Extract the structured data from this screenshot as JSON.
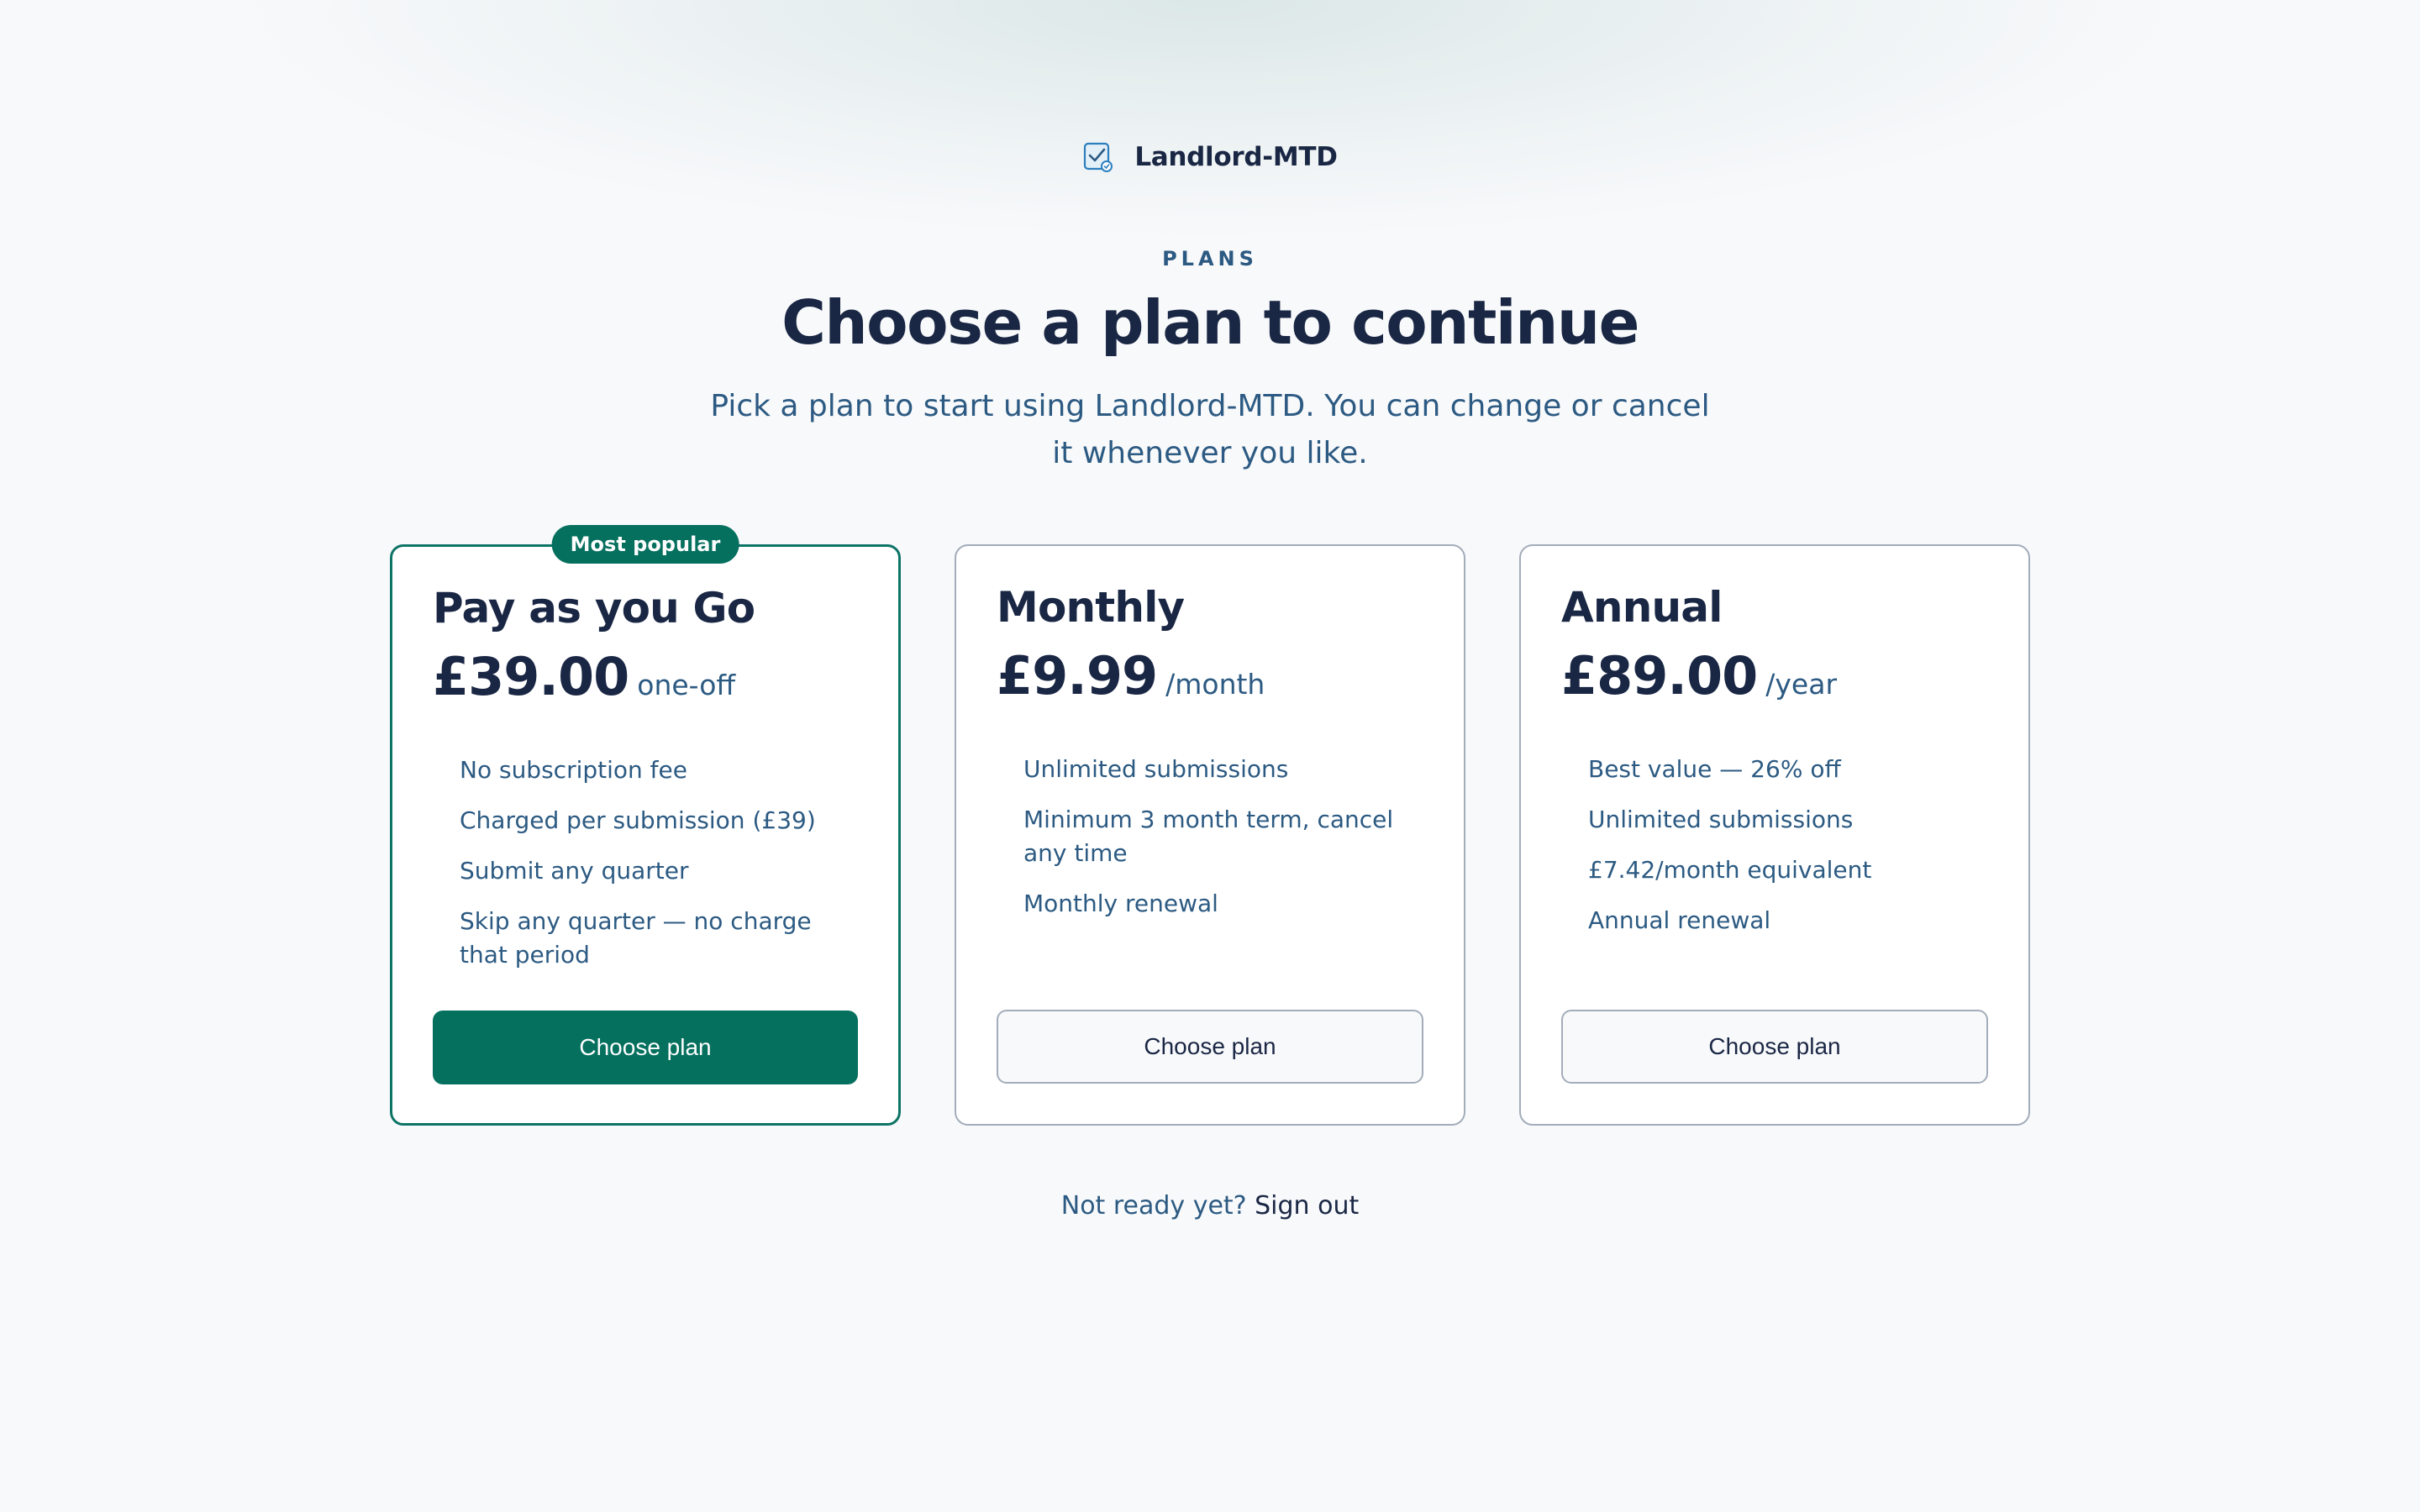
{
  "brand": {
    "name": "Landlord-MTD",
    "icon": "checklist-icon"
  },
  "header": {
    "eyebrow": "PLANS",
    "title": "Choose a plan to continue",
    "subtitle": "Pick a plan to start using Landlord-MTD. You can change or cancel it whenever you like."
  },
  "plans": [
    {
      "name": "Pay as you Go",
      "badge": "Most popular",
      "price": "£39.00",
      "period": "one-off",
      "features": [
        "No subscription fee",
        "Charged per submission (£39)",
        "Submit any quarter",
        "Skip any quarter — no charge that period"
      ],
      "cta": "Choose plan"
    },
    {
      "name": "Monthly",
      "price": "£9.99",
      "period": "/month",
      "features": [
        "Unlimited submissions",
        "Minimum 3 month term, cancel any time",
        "Monthly renewal"
      ],
      "cta": "Choose plan"
    },
    {
      "name": "Annual",
      "price": "£89.00",
      "period": "/year",
      "features": [
        "Best value — 26% off",
        "Unlimited submissions",
        "£7.42/month equivalent",
        "Annual renewal"
      ],
      "cta": "Choose plan"
    }
  ],
  "footer": {
    "prompt": "Not ready yet?",
    "link": "Sign out"
  },
  "colors": {
    "accent": "#06705f",
    "heading": "#1a2744",
    "body": "#2c5a82",
    "border": "#a3adba",
    "background": "#f8f9fb"
  }
}
